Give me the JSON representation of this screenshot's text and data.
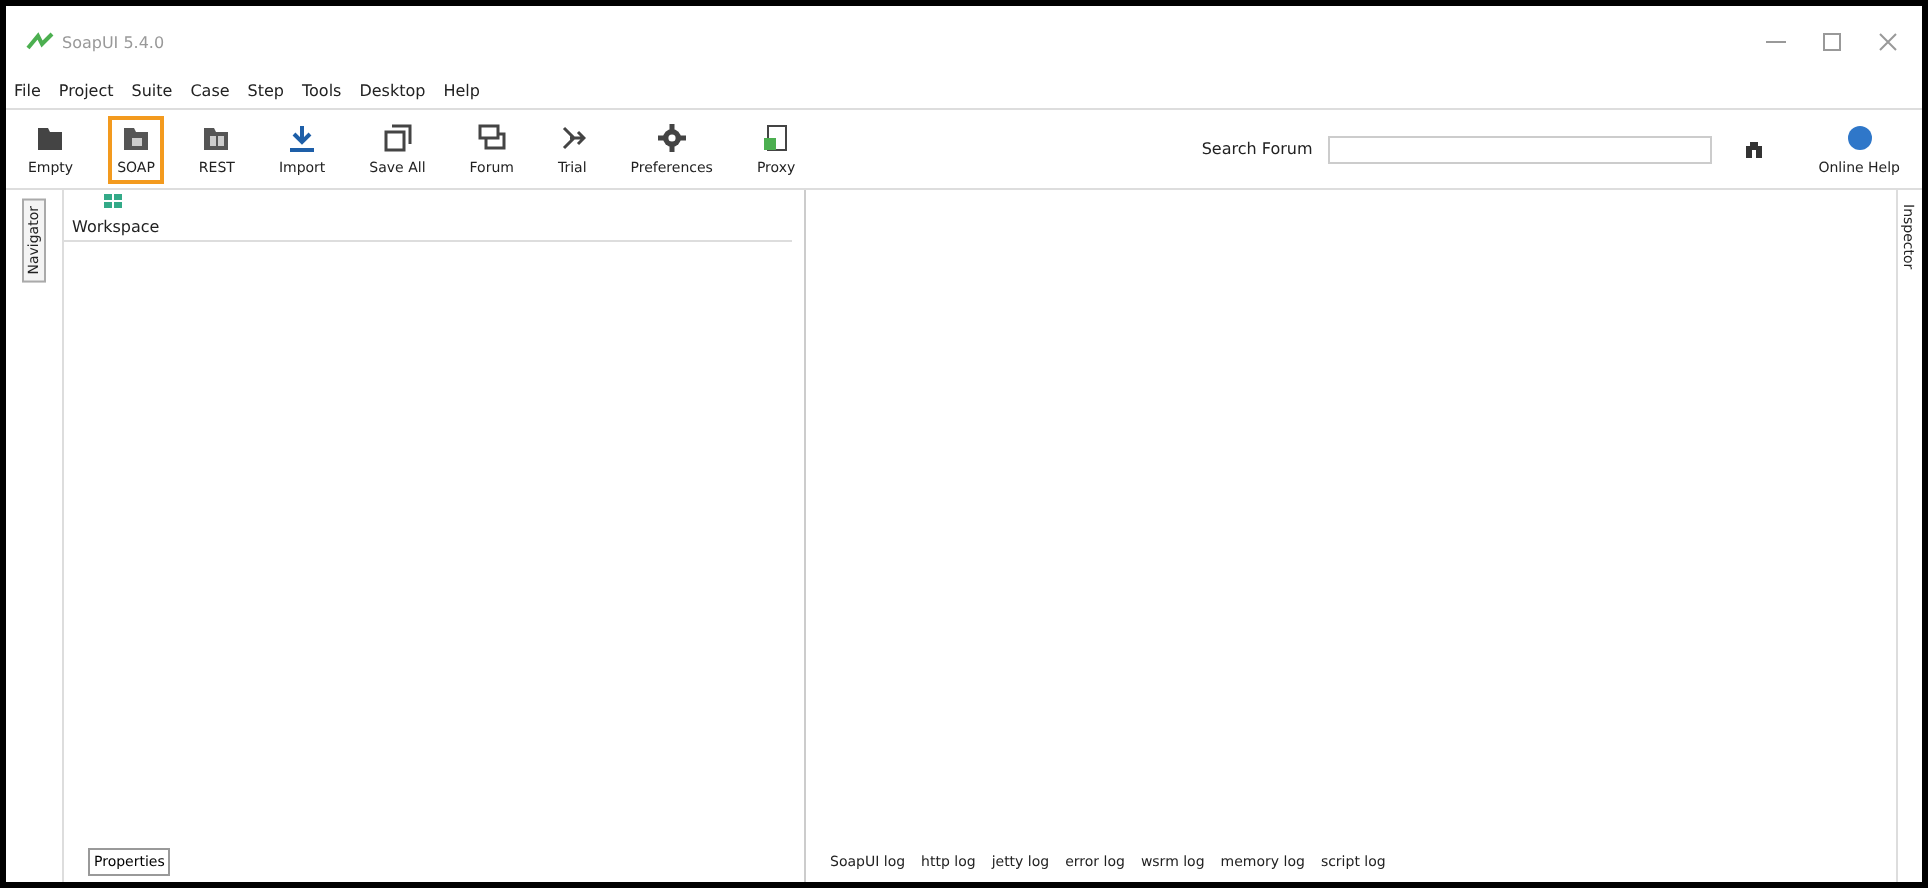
{
  "window": {
    "title": "SoapUI 5.4.0"
  },
  "menu": [
    "File",
    "Project",
    "Suite",
    "Case",
    "Step",
    "Tools",
    "Desktop",
    "Help"
  ],
  "toolbar": [
    {
      "label": "Empty",
      "kind": "empty",
      "selected": false
    },
    {
      "label": "SOAP",
      "kind": "soap",
      "selected": true
    },
    {
      "label": "REST",
      "kind": "rest",
      "selected": false
    },
    {
      "label": "Import",
      "kind": "import",
      "selected": false
    },
    {
      "label": "Save All",
      "kind": "save",
      "selected": false
    },
    {
      "label": "Forum",
      "kind": "forum",
      "selected": false
    },
    {
      "label": "Trial",
      "kind": "trial",
      "selected": false
    },
    {
      "label": "Preferences",
      "kind": "gear",
      "selected": false
    },
    {
      "label": "Proxy",
      "kind": "proxy",
      "selected": false
    }
  ],
  "search": {
    "label": "Search Forum"
  },
  "help": {
    "label": "Online Help"
  },
  "navigator": {
    "tab": "Navigator",
    "tree": [
      {
        "label": "Workspace"
      }
    ],
    "properties_button": "Properties"
  },
  "inspector": {
    "tab": "Inspector"
  },
  "logs": [
    "SoapUI log",
    "http log",
    "jetty log",
    "error log",
    "wsrm log",
    "memory log",
    "script log"
  ]
}
